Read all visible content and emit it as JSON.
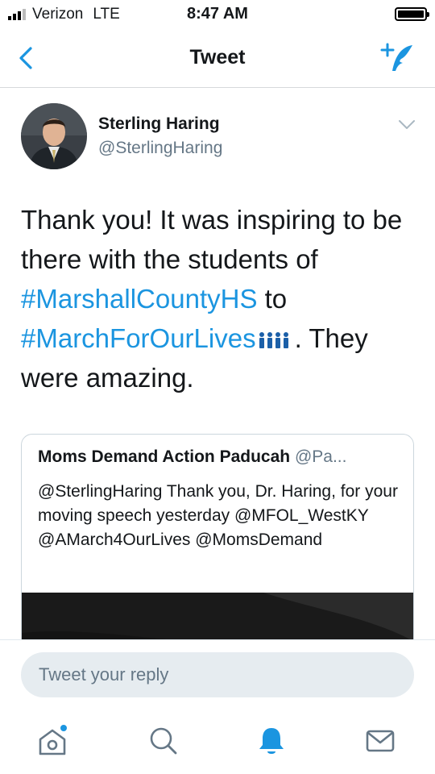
{
  "status_bar": {
    "carrier": "Verizon",
    "network": "LTE",
    "time": "8:47 AM"
  },
  "header": {
    "title": "Tweet",
    "back_icon": "chevron-left-icon",
    "compose_icon": "compose-tweet-icon"
  },
  "tweet": {
    "author_name": "Sterling Haring",
    "author_handle": "@SterlingHaring",
    "text_1": "Thank you! It was inspiring to be there with the students of",
    "hashtag_1": "#MarshallCountyHS",
    "text_2": "to",
    "hashtag_2": "#MarchForOurLives",
    "text_3": ". They were amazing."
  },
  "quoted_tweet": {
    "author_name": "Moms Demand Action Paducah",
    "author_handle": "@Pa...",
    "text": "@SterlingHaring Thank you, Dr. Haring, for your moving speech yesterday @MFOL_WestKY @AMarch4OurLives @MomsDemand"
  },
  "reply": {
    "placeholder": "Tweet your reply"
  },
  "tab_bar": {
    "items": [
      "home-icon",
      "search-icon",
      "notifications-icon",
      "messages-icon"
    ]
  },
  "colors": {
    "accent": "#1b95e0",
    "secondary_text": "#657786",
    "reply_bg": "#e6ecf0"
  }
}
